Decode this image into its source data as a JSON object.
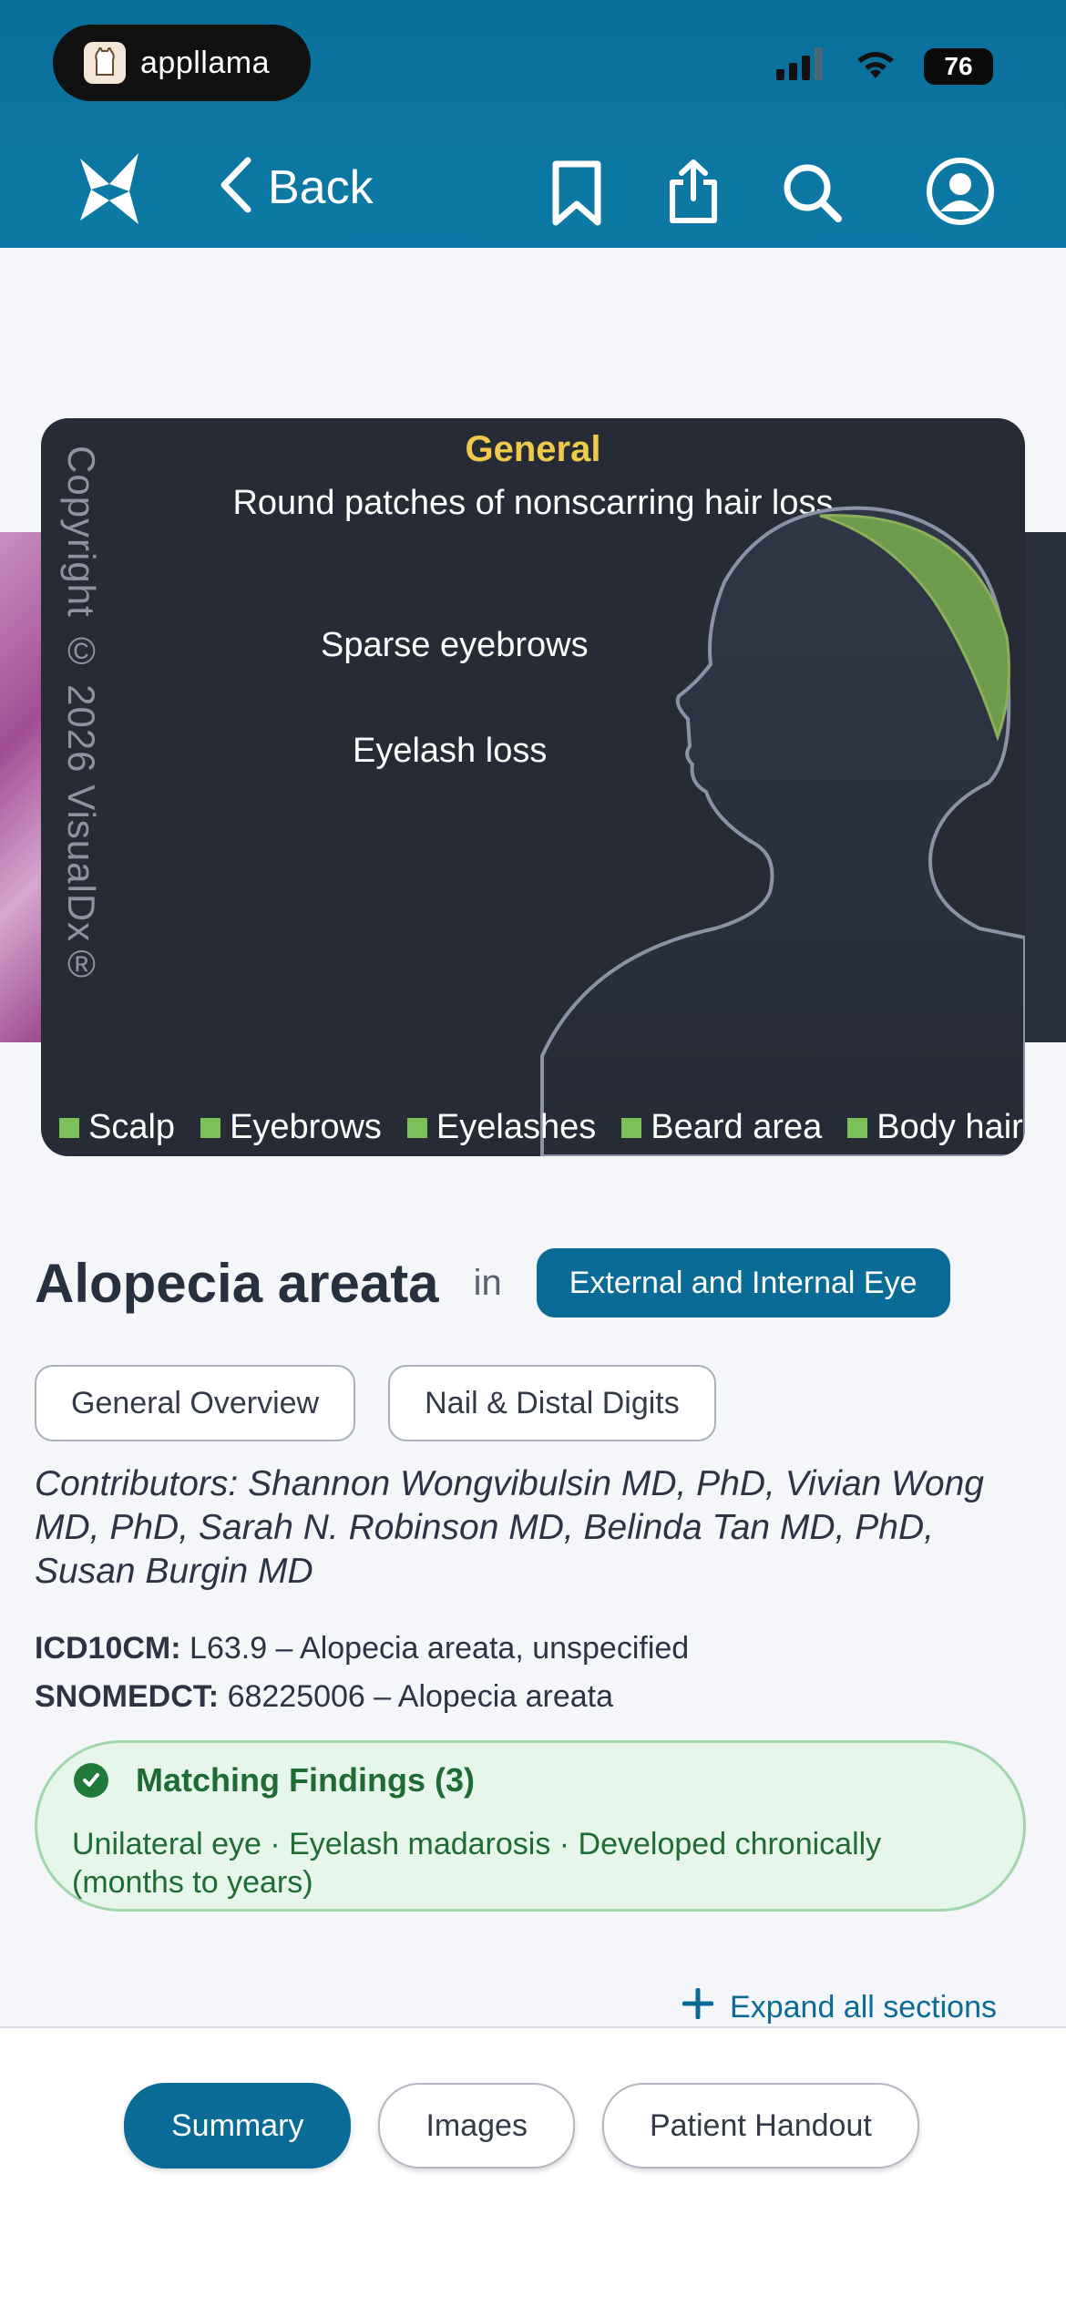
{
  "status_bar": {
    "app_name": "appllama",
    "battery": "76"
  },
  "nav": {
    "back_label": "Back"
  },
  "figure": {
    "heading": "General",
    "subtitle": "Round patches of nonscarring hair loss",
    "label_eyebrows": "Sparse eyebrows",
    "label_eyelash": "Eyelash loss",
    "copyright": "Copyright © 2026 VisualDx®",
    "legend": [
      "Scalp",
      "Eyebrows",
      "Eyelashes",
      "Beard area",
      "Body hair"
    ],
    "accent_color": "#7cc05a",
    "heading_color": "#f0c84a"
  },
  "title": {
    "name": "Alopecia areata",
    "in_word": "in",
    "category": "External and Internal Eye"
  },
  "chips": [
    "General Overview",
    "Nail & Distal Digits"
  ],
  "contributors": "Contributors: Shannon Wongvibulsin MD, PhD, Vivian Wong MD, PhD, Sarah N. Robinson MD, Belinda Tan MD, PhD, Susan Burgin MD",
  "codes": {
    "icd_label": "ICD10CM:",
    "icd_value": "L63.9 – Alopecia areata, unspecified",
    "snomed_label": "SNOMEDCT:",
    "snomed_value": "68225006 – Alopecia areata"
  },
  "findings": {
    "title": "Matching Findings (3)",
    "text": "Unilateral eye · Eyelash madarosis · Developed chronically (months to years)"
  },
  "expand_label": "Expand all sections",
  "tabs": [
    "Summary",
    "Images",
    "Patient Handout"
  ],
  "colors": {
    "brand": "#0a6c96",
    "findings_bg": "#e7f6ea",
    "findings_text": "#1f6b34"
  }
}
